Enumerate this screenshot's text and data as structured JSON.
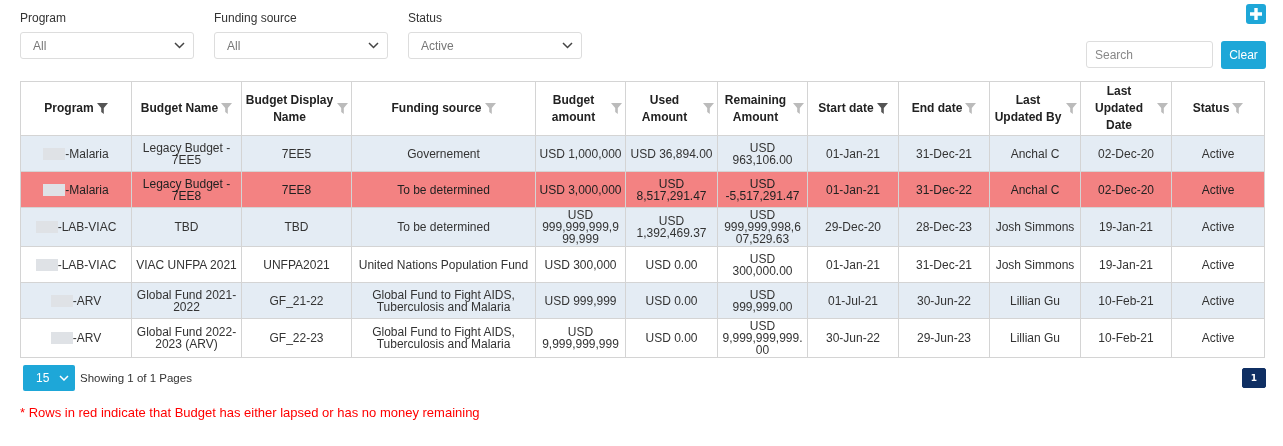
{
  "filters": [
    {
      "label": "Program",
      "value": "All"
    },
    {
      "label": "Funding source",
      "value": "All"
    },
    {
      "label": "Status",
      "value": "Active"
    }
  ],
  "search": {
    "placeholder": "Search"
  },
  "clear_button": "Clear",
  "table": {
    "columns": [
      {
        "label": "Program",
        "filter_active": true
      },
      {
        "label": "Budget Name",
        "filter_active": false
      },
      {
        "label": "Budget Display Name",
        "filter_active": false
      },
      {
        "label": "Funding source",
        "filter_active": false
      },
      {
        "label": "Budget amount",
        "filter_active": false
      },
      {
        "label": "Used Amount",
        "filter_active": false
      },
      {
        "label": "Remaining Amount",
        "filter_active": false
      },
      {
        "label": "Start date",
        "filter_active": true
      },
      {
        "label": "End date",
        "filter_active": false
      },
      {
        "label": "Last Updated By",
        "filter_active": false
      },
      {
        "label": "Last Updated Date",
        "filter_active": false
      },
      {
        "label": "Status",
        "filter_active": false
      }
    ],
    "rows": [
      {
        "lapsed": false,
        "cells": [
          "-Malaria",
          "Legacy Budget - 7EE5",
          "7EE5",
          "Governement",
          "USD 1,000,000",
          "USD 36,894.00",
          "USD 963,106.00",
          "01-Jan-21",
          "31-Dec-21",
          "Anchal C",
          "02-Dec-20",
          "Active"
        ]
      },
      {
        "lapsed": true,
        "cells": [
          "-Malaria",
          "Legacy Budget - 7EE8",
          "7EE8",
          "To be determined",
          "USD 3,000,000",
          "USD 8,517,291.47",
          "USD -5,517,291.47",
          "01-Jan-21",
          "31-Dec-22",
          "Anchal C",
          "02-Dec-20",
          "Active"
        ]
      },
      {
        "lapsed": false,
        "cells": [
          "-LAB-VIAC",
          "TBD",
          "TBD",
          "To be determined",
          "USD 999,999,999,999,999",
          "USD 1,392,469.37",
          "USD 999,999,998,607,529.63",
          "29-Dec-20",
          "28-Dec-23",
          "Josh Simmons",
          "19-Jan-21",
          "Active"
        ]
      },
      {
        "lapsed": false,
        "cells": [
          "-LAB-VIAC",
          "VIAC UNFPA 2021",
          "UNFPA2021",
          "United Nations Population Fund",
          "USD 300,000",
          "USD 0.00",
          "USD 300,000.00",
          "01-Jan-21",
          "31-Dec-21",
          "Josh Simmons",
          "19-Jan-21",
          "Active"
        ]
      },
      {
        "lapsed": false,
        "cells": [
          "-ARV",
          "Global Fund 2021-2022",
          "GF_21-22",
          "Global Fund to Fight AIDS, Tuberculosis and Malaria",
          "USD 999,999",
          "USD 0.00",
          "USD 999,999.00",
          "01-Jul-21",
          "30-Jun-22",
          "Lillian Gu",
          "10-Feb-21",
          "Active"
        ]
      },
      {
        "lapsed": false,
        "cells": [
          "-ARV",
          "Global Fund 2022-2023 (ARV)",
          "GF_22-23",
          "Global Fund to Fight AIDS, Tuberculosis and Malaria",
          "USD 9,999,999,999",
          "USD 0.00",
          "USD 9,999,999,999.00",
          "30-Jun-22",
          "29-Jun-23",
          "Lillian Gu",
          "10-Feb-21",
          "Active"
        ]
      }
    ]
  },
  "page_size": "15",
  "showing": "Showing 1 of 1 Pages",
  "pages": [
    {
      "label": "1",
      "selected": true
    }
  ],
  "note": "* Rows in red indicate that Budget has either lapsed or has no money remaining"
}
